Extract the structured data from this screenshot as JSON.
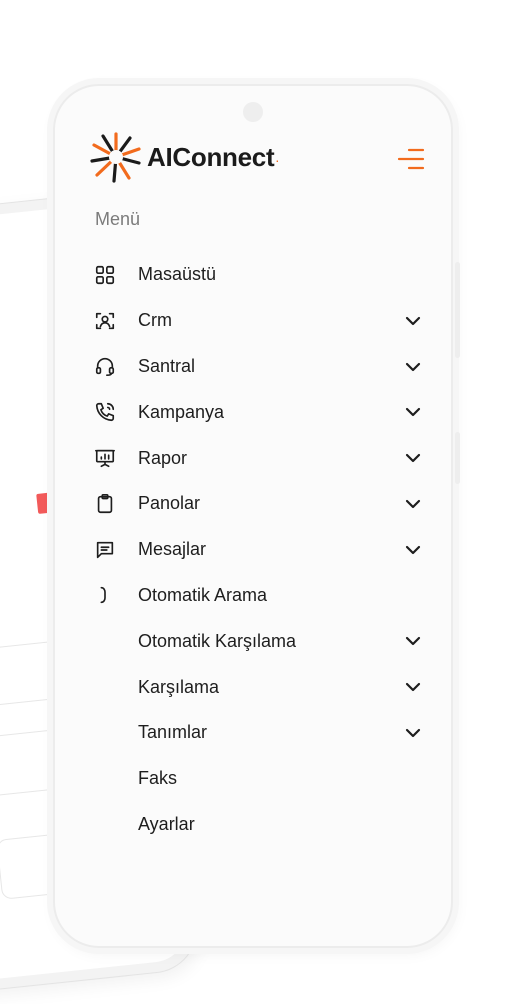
{
  "brand": {
    "name": "AIConnect",
    "dot": ".",
    "accent_color": "#f26b1d"
  },
  "menu": {
    "title": "Menü",
    "items": [
      {
        "label": "Masaüstü",
        "icon": "dashboard-grid-icon",
        "has_submenu": false
      },
      {
        "label": "Crm",
        "icon": "contact-scan-icon",
        "has_submenu": true
      },
      {
        "label": "Santral",
        "icon": "headset-icon",
        "has_submenu": true
      },
      {
        "label": "Kampanya",
        "icon": "phone-call-icon",
        "has_submenu": true
      },
      {
        "label": "Rapor",
        "icon": "presentation-chart-icon",
        "has_submenu": true
      },
      {
        "label": "Panolar",
        "icon": "clipboard-icon",
        "has_submenu": true
      },
      {
        "label": "Mesajlar",
        "icon": "message-icon",
        "has_submenu": true
      },
      {
        "label": "Otomatik Arama",
        "icon": "auto-dial-icon",
        "has_submenu": false
      },
      {
        "label": "Otomatik Karşılama",
        "icon": "auto-answer-icon",
        "has_submenu": true
      },
      {
        "label": "Karşılama",
        "icon": "welcome-icon",
        "has_submenu": true
      },
      {
        "label": "Tanımlar",
        "icon": "definitions-icon",
        "has_submenu": true
      },
      {
        "label": "Faks",
        "icon": "fax-icon",
        "has_submenu": false
      },
      {
        "label": "Ayarlar",
        "icon": "settings-icon",
        "has_submenu": false
      }
    ]
  }
}
